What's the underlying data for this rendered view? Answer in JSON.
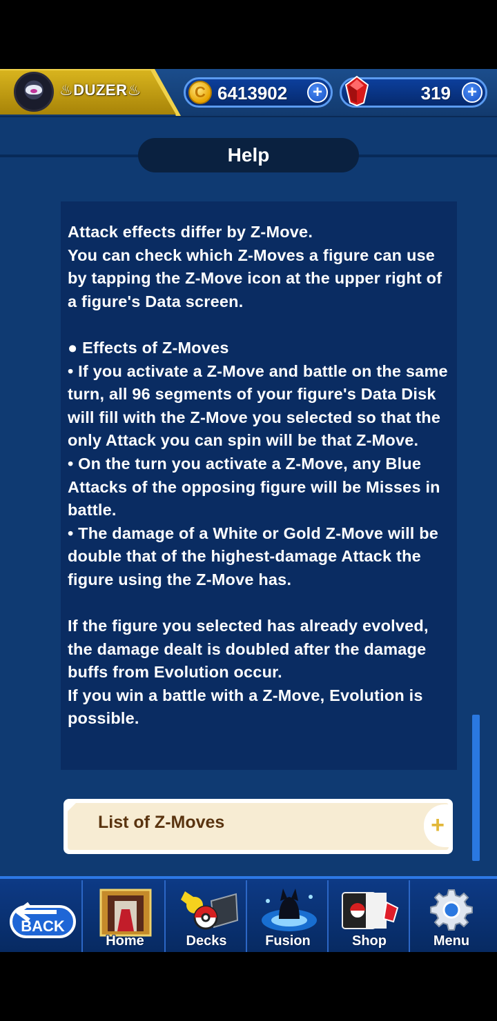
{
  "player": {
    "name": "♨DUZER♨"
  },
  "currency": {
    "coins": "6413902",
    "gems": "319",
    "coin_symbol": "C"
  },
  "help": {
    "title": "Help",
    "body": "Attack effects differ by Z-Move.\nYou can check which Z-Moves a figure can use by tapping the Z-Move icon at the upper right of a figure's Data screen.\n\n● Effects of Z-Moves\n• If you activate a Z-Move and battle on the same turn, all 96 segments of your figure's Data Disk will fill with the Z-Move you selected so that the only Attack you can spin will be that Z-Move.\n• On the turn you activate a Z-Move, any Blue Attacks of the opposing figure will be Misses in battle.\n• The damage of a White or Gold Z-Move will be double that of the highest-damage Attack the figure using the Z-Move has.\n\nIf the figure you selected has already evolved, the damage dealt is doubled after the damage buffs from Evolution occur.\nIf you win a battle with a Z-Move, Evolution is possible.",
    "list_button": "List of Z-Moves",
    "list_plus": "+"
  },
  "nav": {
    "back": "BACK",
    "items": [
      {
        "label": "Home",
        "icon": "home-icon"
      },
      {
        "label": "Decks",
        "icon": "decks-icon"
      },
      {
        "label": "Fusion",
        "icon": "fusion-icon"
      },
      {
        "label": "Shop",
        "icon": "shop-icon"
      },
      {
        "label": "Menu",
        "icon": "gear-icon"
      }
    ]
  },
  "colors": {
    "background": "#0f3a72",
    "panel": "#0a2c62",
    "gold": "#d8b41e",
    "accent": "#2a78e0"
  }
}
